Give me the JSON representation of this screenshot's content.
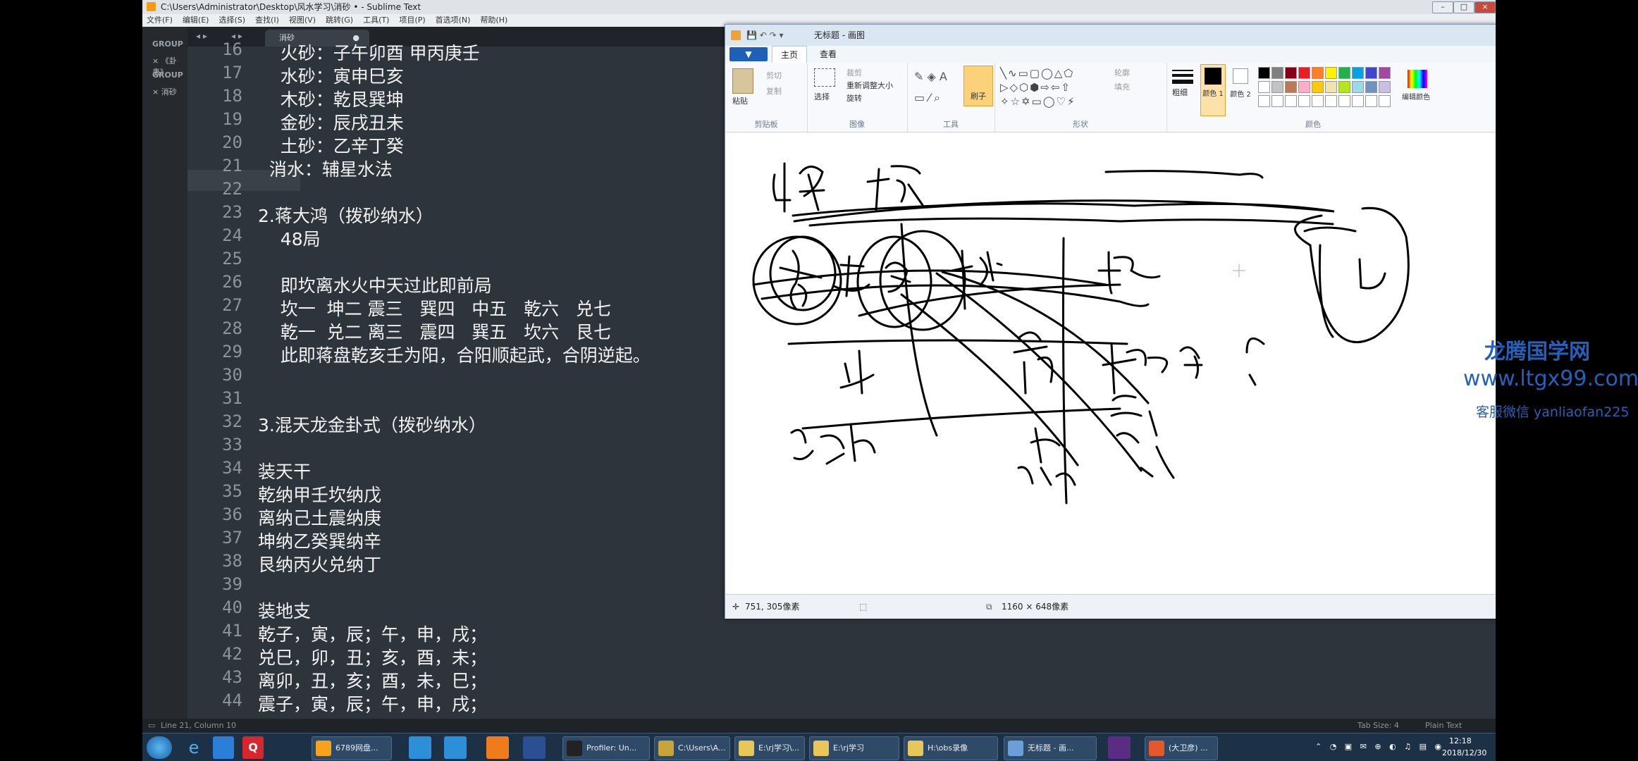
{
  "sublime": {
    "title": "C:\\Users\\Administrator\\Desktop\\风水学习\\消砂 • - Sublime Text",
    "menu": [
      "文件(F)",
      "编辑(E)",
      "选择(S)",
      "查找(I)",
      "视图(V)",
      "跳转(G)",
      "工具(T)",
      "项目(P)",
      "首选项(N)",
      "帮助(H)"
    ],
    "sidebar": {
      "group1": "GROUP",
      "file1": "× 《卦蛊》",
      "group2": "GROUP",
      "file2": "× 消砂"
    },
    "tab": {
      "label": "消砂",
      "dirty": "●"
    },
    "status_left": "Line 21, Column 10",
    "status_tab": "Tab Size: 4",
    "status_syntax": "Plain Text"
  },
  "code_lines": [
    {
      "n": "16",
      "t": "    火砂：子午卯酉 甲丙庚壬"
    },
    {
      "n": "17",
      "t": "    水砂：寅申巳亥"
    },
    {
      "n": "18",
      "t": "    木砂：乾艮巽坤"
    },
    {
      "n": "19",
      "t": "    金砂：辰戌丑未"
    },
    {
      "n": "20",
      "t": "    土砂：乙辛丁癸"
    },
    {
      "n": "21",
      "t": "  消水：辅星水法"
    },
    {
      "n": "22",
      "t": ""
    },
    {
      "n": "23",
      "t": "2.蒋大鸿（拨砂纳水）"
    },
    {
      "n": "24",
      "t": "    48局"
    },
    {
      "n": "25",
      "t": ""
    },
    {
      "n": "26",
      "t": "    即坎离水火中天过此即前局"
    },
    {
      "n": "27",
      "t": "    坎一  坤二 震三   巽四   中五   乾六   兑七"
    },
    {
      "n": "28",
      "t": "    乾一  兑二 离三   震四   巽五   坎六   艮七"
    },
    {
      "n": "29",
      "t": "    此即蒋盘乾亥壬为阳，合阳顺起武，合阴逆起。"
    },
    {
      "n": "30",
      "t": ""
    },
    {
      "n": "31",
      "t": ""
    },
    {
      "n": "32",
      "t": "3.混天龙金卦式（拨砂纳水）"
    },
    {
      "n": "33",
      "t": ""
    },
    {
      "n": "34",
      "t": "装天干"
    },
    {
      "n": "35",
      "t": "乾纳甲壬坎纳戊"
    },
    {
      "n": "36",
      "t": "离纳己土震纳庚"
    },
    {
      "n": "37",
      "t": "坤纳乙癸巽纳辛"
    },
    {
      "n": "38",
      "t": "艮纳丙火兑纳丁"
    },
    {
      "n": "39",
      "t": ""
    },
    {
      "n": "40",
      "t": "装地支"
    },
    {
      "n": "41",
      "t": "乾子，寅，辰；午，申，戌；"
    },
    {
      "n": "42",
      "t": "兑巳，卯，丑；亥，酉，未；"
    },
    {
      "n": "43",
      "t": "离卯，丑，亥；酉，未，巳；"
    },
    {
      "n": "44",
      "t": "震子，寅，辰；午，申，戌；"
    }
  ],
  "paint": {
    "title": "无标题 - 画图",
    "file_tab": "▼",
    "tabs": [
      "主页",
      "查看"
    ],
    "groups": [
      "剪贴板",
      "图像",
      "工具",
      "形状",
      "颜色"
    ],
    "clipboard": {
      "paste": "粘贴",
      "cut": "剪切",
      "copy": "复制"
    },
    "image": {
      "select": "选择",
      "crop": "裁剪",
      "resize": "重新调整大小",
      "rotate": "旋转"
    },
    "brush": "刷子",
    "shapes": {
      "outline": "轮廓",
      "fill": "填充"
    },
    "size": "粗细",
    "color1": "颜色 1",
    "color2": "颜色 2",
    "edit_colors": "编辑颜色",
    "status_pos": "751, 305像素",
    "status_size": "1160 × 648像素",
    "palette": [
      "#000000",
      "#7f7f7f",
      "#880015",
      "#ed1c24",
      "#ff7f27",
      "#fff200",
      "#22b14c",
      "#00a2e8",
      "#3f48cc",
      "#a349a4",
      "#ffffff",
      "#c3c3c3",
      "#b97a57",
      "#ffaec9",
      "#ffc90e",
      "#efe4b0",
      "#b5e61d",
      "#99d9ea",
      "#7092be",
      "#c8bfe7"
    ]
  },
  "taskbar": {
    "items": [
      "6789网盘...",
      "Profiler: Un...",
      "C:\\Users\\A...",
      "E:\\rj学习\\...",
      "E:\\rj学习",
      "H:\\obs录像",
      "无标题 - 画...",
      "(大卫彦) ..."
    ],
    "time": "12:18",
    "date": "2018/12/30"
  },
  "watermark": {
    "line1": "龙腾国学网",
    "line2": "www.ltgx99.com",
    "line3": "客服微信 yanliaofan225"
  }
}
